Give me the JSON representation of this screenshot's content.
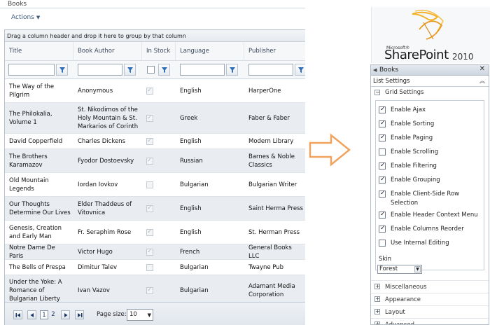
{
  "left": {
    "webpart_title": "Books",
    "actions_label": "Actions",
    "group_panel_text": "Drag a column header and drop it here to group by that column",
    "columns": [
      "Title",
      "Book Author",
      "In Stock",
      "Language",
      "Publisher"
    ],
    "rows": [
      {
        "title": "The Way of the Pilgrim",
        "author": "Anonymous",
        "in_stock": true,
        "language": "English",
        "publisher": "HarperOne"
      },
      {
        "title": "The Philokalia, Volume 1",
        "author": "St. Nikodimos of the Holy Mountain & St. Markarios of Corinth",
        "in_stock": true,
        "language": "Greek",
        "publisher": "Faber & Faber"
      },
      {
        "title": "David Copperfield",
        "author": "Charles Dickens",
        "in_stock": true,
        "language": "English",
        "publisher": "Modern Library"
      },
      {
        "title": "The Brothers Karamazov",
        "author": "Fyodor Dostoevsky",
        "in_stock": true,
        "language": "Russian",
        "publisher": "Barnes & Noble Classics"
      },
      {
        "title": "Old Mountain Legends",
        "author": "Iordan Iovkov",
        "in_stock": false,
        "language": "Bulgarian",
        "publisher": "Bulgarian Writer"
      },
      {
        "title": "Our Thoughts Determine Our Lives",
        "author": "Elder Thaddeus of Vitovnica",
        "in_stock": true,
        "language": "English",
        "publisher": "Saint Herma Press"
      },
      {
        "title": "Genesis, Creation and Early Man",
        "author": "Fr. Seraphim Rose",
        "in_stock": true,
        "language": "English",
        "publisher": "St. Herman Press"
      },
      {
        "title": "Notre Dame De Paris",
        "author": "Victor Hugo",
        "in_stock": true,
        "language": "French",
        "publisher": "General Books LLC"
      },
      {
        "title": "The Bells of Prespa",
        "author": "Dimitur Talev",
        "in_stock": false,
        "language": "Bulgarian",
        "publisher": "Twayne Pub"
      },
      {
        "title": "Under the Yoke: A Romance of Bulgarian Liberty",
        "author": "Ivan Vazov",
        "in_stock": true,
        "language": "Bulgarian",
        "publisher": "Adamant Media Corporation"
      }
    ],
    "pager": {
      "pages": [
        "1",
        "2"
      ],
      "current_page": "1",
      "page_size_label": "Page size:",
      "page_size_value": "10"
    }
  },
  "right": {
    "logo_microsoft": "Microsoft®",
    "logo_product": "SharePoint",
    "logo_version": "2010",
    "panel_title": "Books",
    "list_settings_label": "List Settings",
    "grid_settings_label": "Grid Settings",
    "options": [
      {
        "label": "Enable Ajax",
        "checked": true
      },
      {
        "label": "Enable Sorting",
        "checked": true
      },
      {
        "label": "Enable Paging",
        "checked": true
      },
      {
        "label": "Enable Scrolling",
        "checked": false
      },
      {
        "label": "Enable Filtering",
        "checked": true
      },
      {
        "label": "Enable Grouping",
        "checked": true
      },
      {
        "label": "Enable Client-Side Row Selection",
        "checked": true
      },
      {
        "label": "Enable Header Context Menu",
        "checked": true
      },
      {
        "label": "Enable Columns Reorder",
        "checked": true
      },
      {
        "label": "Use Internal Editing",
        "checked": false
      }
    ],
    "skin_label": "Skin",
    "skin_value": "Forest",
    "sections": [
      "Miscellaneous",
      "Appearance",
      "Layout",
      "Advanced"
    ]
  },
  "colors": {
    "accent_blue": "#3d5a80",
    "arrow_orange": "#f0a35e",
    "alt_row": "#e9edf2"
  }
}
